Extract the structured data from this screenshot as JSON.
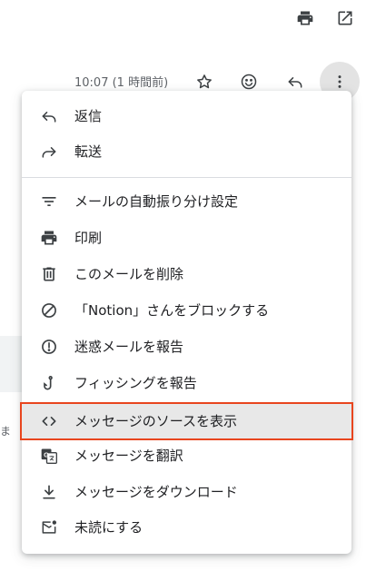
{
  "header": {
    "time": "10:07 (1 時間前)"
  },
  "background": {
    "partial_text": "ま"
  },
  "menu": {
    "items": [
      {
        "label": "返信",
        "icon": "reply-icon"
      },
      {
        "label": "転送",
        "icon": "forward-icon"
      },
      {
        "label": "メールの自動振り分け設定",
        "icon": "filter-icon"
      },
      {
        "label": "印刷",
        "icon": "print-icon"
      },
      {
        "label": "このメールを削除",
        "icon": "trash-icon"
      },
      {
        "label": "「Notion」さんをブロックする",
        "icon": "block-icon"
      },
      {
        "label": "迷惑メールを報告",
        "icon": "spam-icon"
      },
      {
        "label": "フィッシングを報告",
        "icon": "phishing-icon"
      },
      {
        "label": "メッセージのソースを表示",
        "icon": "code-icon"
      },
      {
        "label": "メッセージを翻訳",
        "icon": "translate-icon"
      },
      {
        "label": "メッセージをダウンロード",
        "icon": "download-icon"
      },
      {
        "label": "未読にする",
        "icon": "mark-unread-icon"
      }
    ]
  },
  "colors": {
    "highlight_border": "#e8451e",
    "hover_bg": "#e8e8e8",
    "icon": "#3c4043"
  }
}
